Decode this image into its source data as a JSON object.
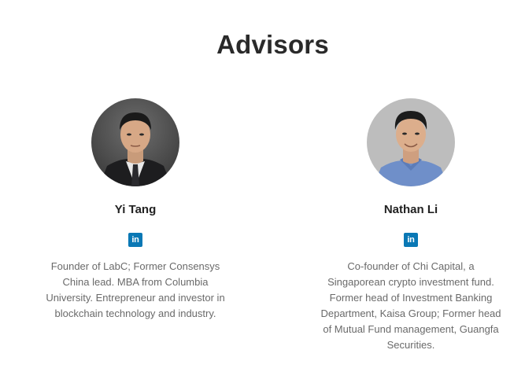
{
  "section": {
    "title": "Advisors"
  },
  "advisors": [
    {
      "name": "Yi Tang",
      "linkedin_icon": "linkedin-icon",
      "linkedin_text": "in",
      "bio": "Founder of LabC; Former Consensys China lead. MBA from Columbia University. Entrepreneur and investor in blockchain technology and industry."
    },
    {
      "name": "Nathan Li",
      "linkedin_icon": "linkedin-icon",
      "linkedin_text": "in",
      "bio": "Co-founder of Chi Capital, a Singaporean crypto investment fund. Former head of Investment Banking Department, Kaisa Group; Former head of Mutual Fund management, Guangfa Securities."
    }
  ],
  "colors": {
    "linkedin": "#0a78b5",
    "title": "#2a2a2a",
    "bio": "#6a6a6a"
  }
}
